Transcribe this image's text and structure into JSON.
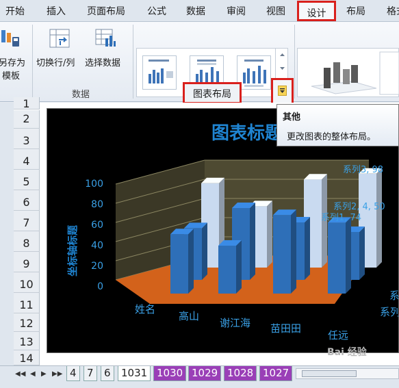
{
  "ribbon": {
    "tabs": [
      "开始",
      "插入",
      "页面布局",
      "公式",
      "数据",
      "审阅",
      "视图",
      "设计",
      "布局",
      "格式"
    ],
    "save_template_label": [
      "另存为",
      "模板"
    ],
    "switch_row_col_label": "切换行/列",
    "select_data_label": "选择数据",
    "data_group_title": "数据",
    "chart_layout_group_title": "图表布局"
  },
  "tooltip": {
    "title": "其他",
    "body": "更改图表的整体布局。"
  },
  "sheet": {
    "row_numbers": [
      "1",
      "2",
      "3",
      "4",
      "5",
      "6",
      "7",
      "8",
      "9",
      "10",
      "11",
      "12",
      "13",
      "14"
    ]
  },
  "chart": {
    "title": "图表标题",
    "axis_title": "坐标轴标题",
    "y_ticks": [
      "100",
      "80",
      "60",
      "40",
      "20",
      "0"
    ],
    "categories": [
      "姓名",
      "高山",
      "谢江海",
      "苗田田",
      "任远"
    ],
    "data_labels": [
      "系列3, 98",
      "系列2, 4, 50",
      "系列1, 74"
    ],
    "series_axis_labels": [
      "系",
      "系列"
    ],
    "colors": {
      "background": "#000000",
      "bar_dark": "#2e6fb8",
      "bar_light": "#c9daf0",
      "floor": "#d3621b",
      "text": "#3aa0e6",
      "title": "#1f84d1"
    }
  },
  "chart_data": {
    "type": "bar",
    "categories": [
      "姓名",
      "高山",
      "谢江海",
      "苗田田",
      "任远"
    ],
    "series": [
      {
        "name": "系列1",
        "values": [
          0,
          62,
          50,
          82,
          74
        ]
      },
      {
        "name": "系列2",
        "values": [
          0,
          54,
          75,
          60,
          50
        ]
      },
      {
        "name": "系列3",
        "values": [
          0,
          88,
          64,
          92,
          98
        ]
      }
    ],
    "title": "图表标题",
    "ylabel": "坐标轴标题",
    "ylim": [
      0,
      100
    ]
  },
  "sheet_tabs": {
    "nav": [
      "◀◀",
      "◀",
      "▶",
      "▶▶"
    ],
    "tabs": [
      "4",
      "7",
      "6",
      "1031",
      "1030",
      "1029",
      "1028",
      "1027"
    ],
    "active": "1031"
  },
  "watermark": "Bai 经验"
}
